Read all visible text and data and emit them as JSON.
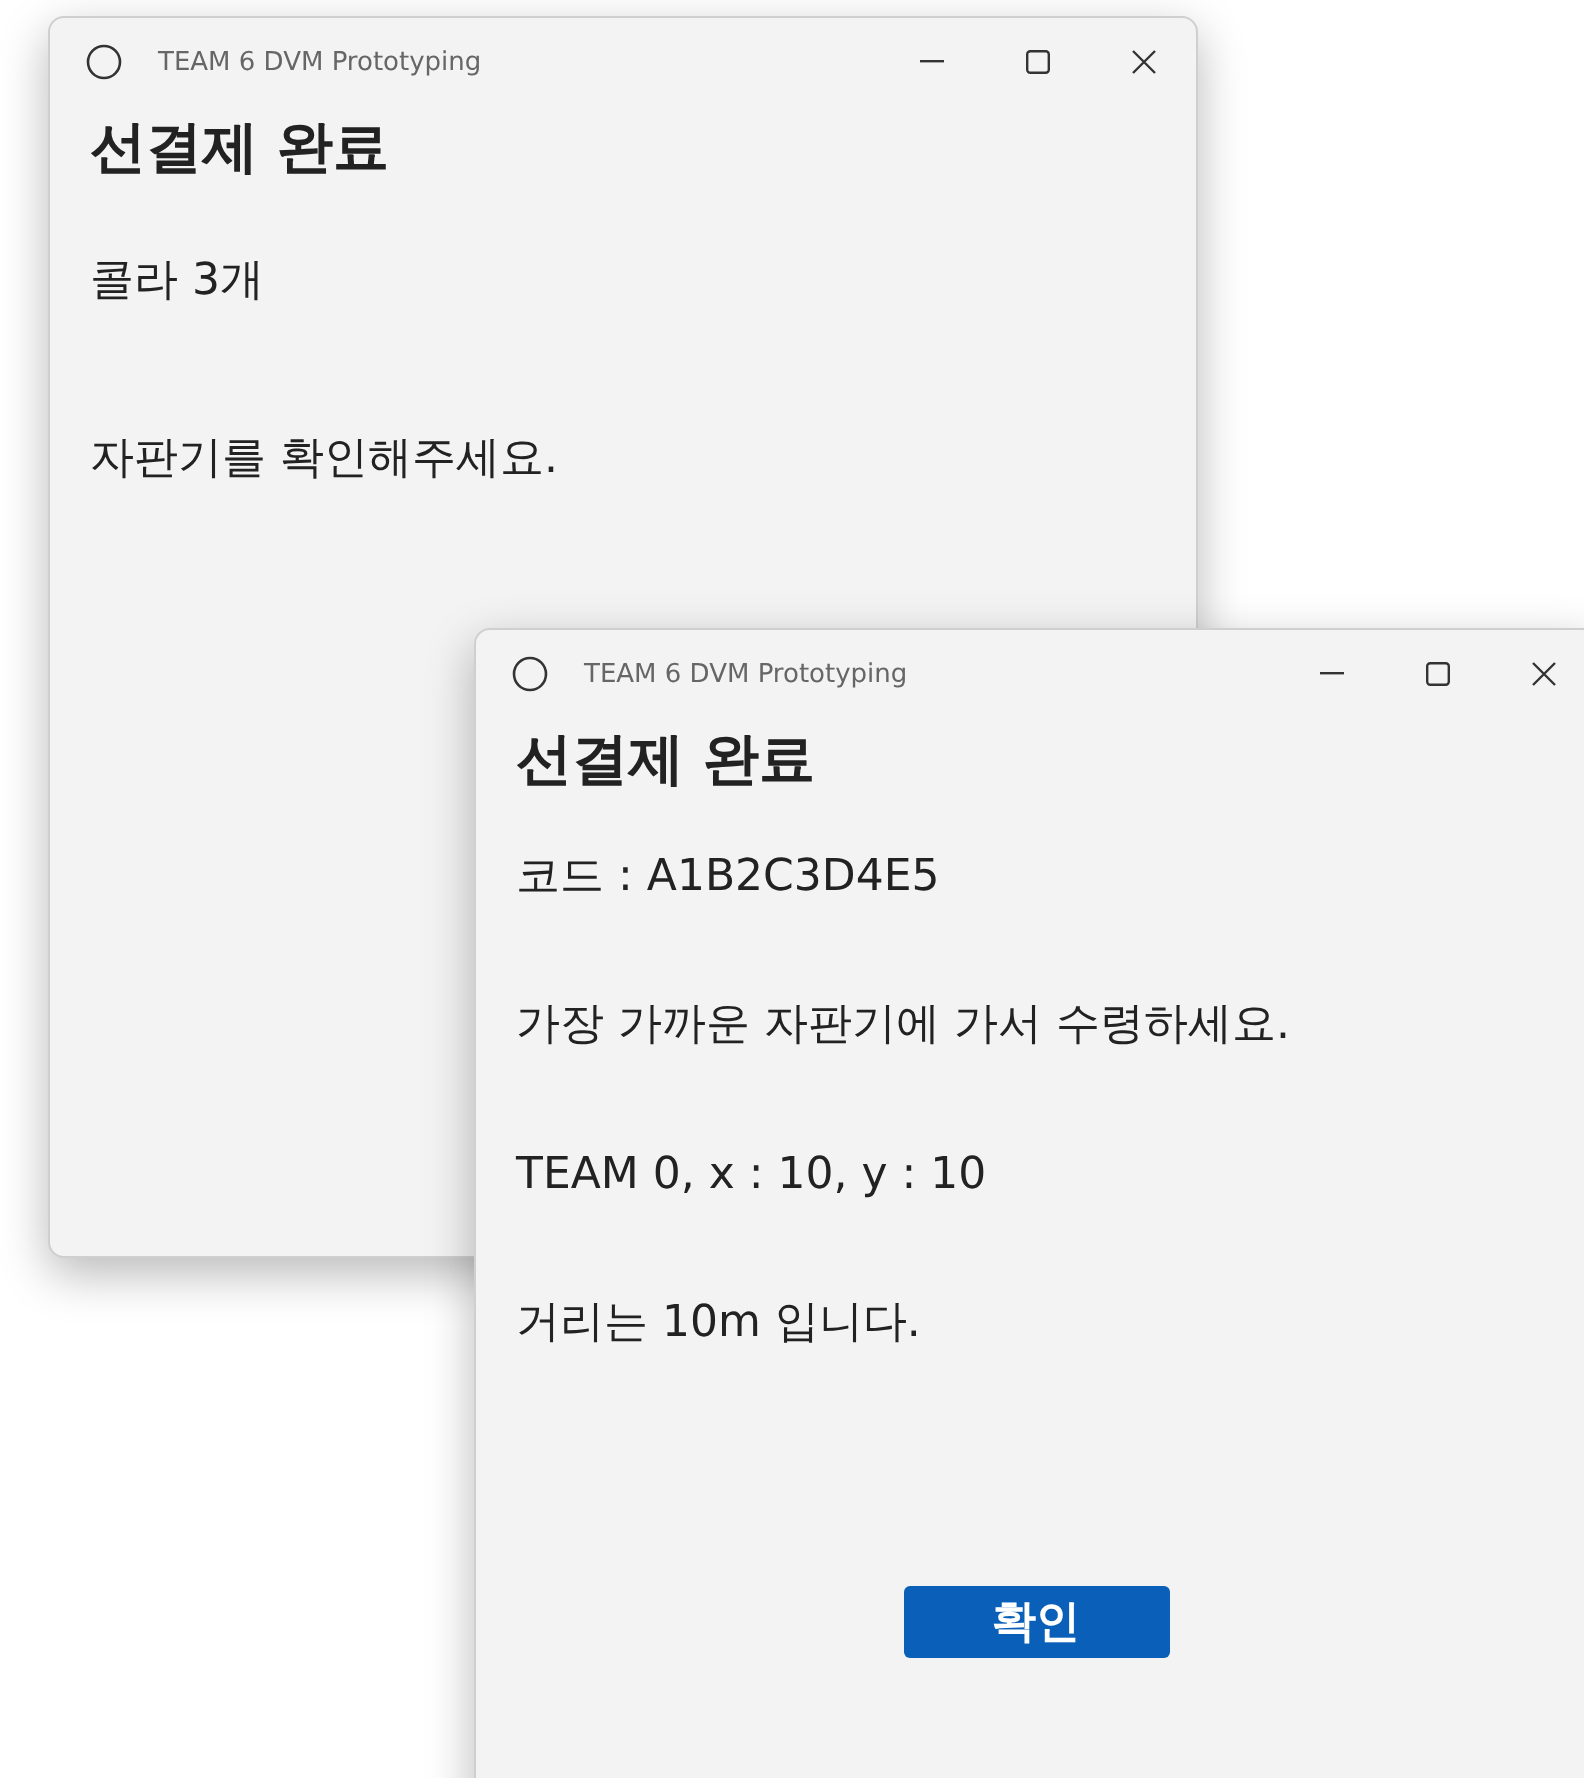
{
  "windows": [
    {
      "title": "TEAM 6 DVM Prototyping",
      "heading": "선결제 완료",
      "lines": [
        "콜라 3개",
        "자판기를 확인해주세요."
      ]
    },
    {
      "title": "TEAM 6 DVM Prototyping",
      "heading": "선결제 완료",
      "lines": [
        "코드 : A1B2C3D4E5",
        "가장 가까운 자판기에 가서 수령하세요.",
        "TEAM 0, x : 10, y : 10",
        "거리는 10m 입니다."
      ],
      "button": "확인"
    }
  ]
}
